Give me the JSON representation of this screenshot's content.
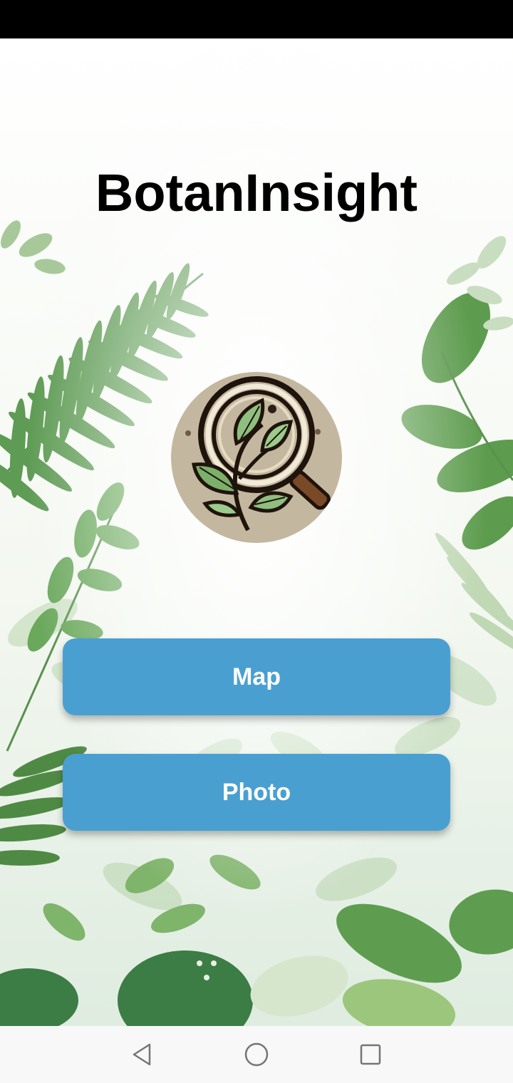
{
  "app": {
    "title": "BotanInsight"
  },
  "buttons": {
    "map_label": "Map",
    "photo_label": "Photo"
  },
  "icons": {
    "logo": "magnifier-leaf-logo-icon",
    "nav_back": "back-triangle-icon",
    "nav_home": "home-circle-icon",
    "nav_recents": "recents-square-icon"
  },
  "colors": {
    "button_bg": "#4a9fd1",
    "button_text": "#ffffff",
    "title_text": "#000000",
    "status_bar": "#000000",
    "nav_bar": "#f8f8f8",
    "leaf_dark": "#3f8a4a",
    "leaf_mid": "#6aa85c",
    "leaf_light": "#a9cf92"
  }
}
